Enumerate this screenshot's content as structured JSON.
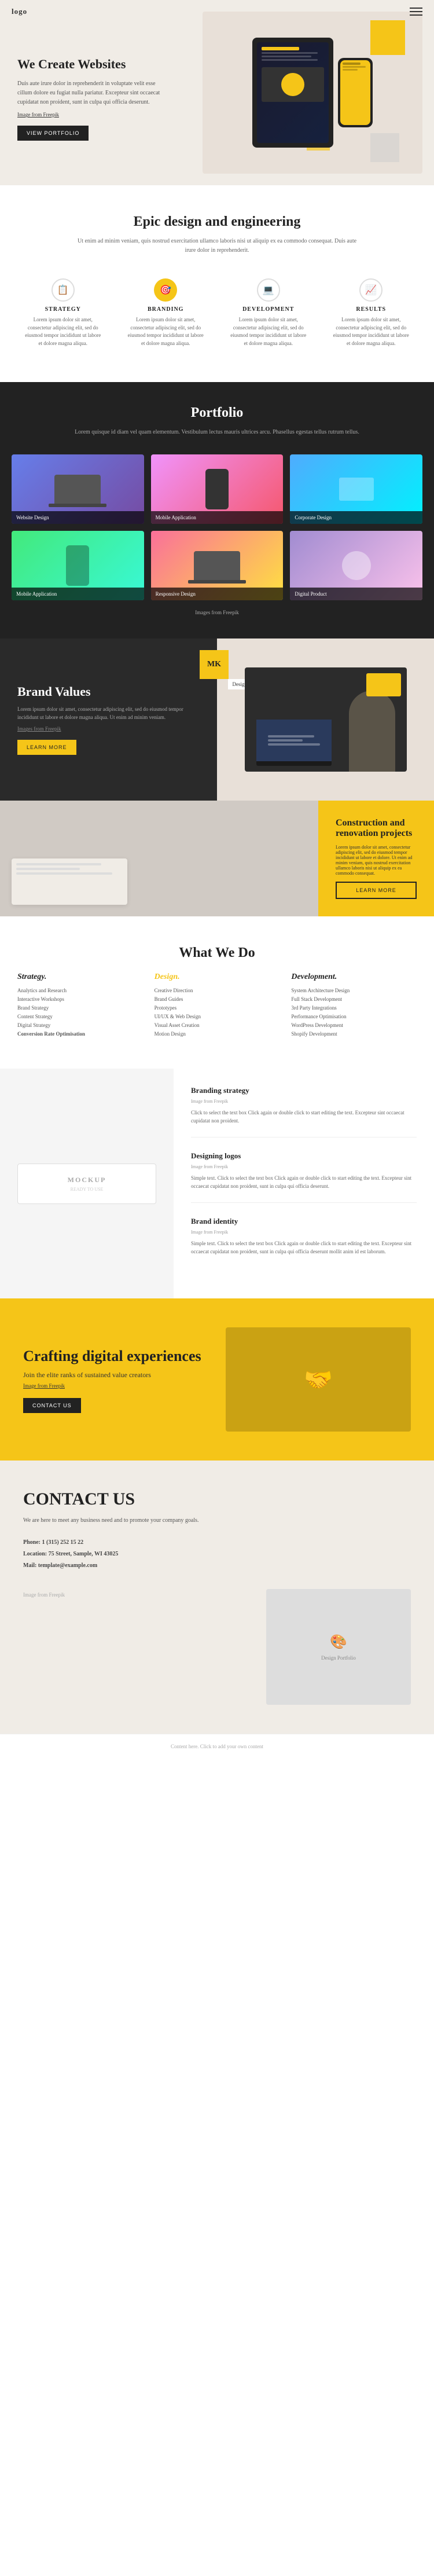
{
  "header": {
    "logo": "logo",
    "menu_icon": "≡"
  },
  "hero": {
    "title": "We Create Websites",
    "description": "Duis aute irure dolor in reprehenderit in voluptate velit esse cillum dolore eu fugiat nulla pariatur. Excepteur sint occaecat cupidatat non proident, sunt in culpa qui officia deserunt.",
    "image_credit": "Image from Freepik",
    "cta_button": "VIEW PORTFOLIO"
  },
  "epic": {
    "title": "Epic design and engineering",
    "subtitle": "Ut enim ad minim veniam, quis nostrud exercitation ullamco laboris nisi ut aliquip ex ea commodo consequat. Duis aute irure dolor in reprehenderit.",
    "features": [
      {
        "label": "STRATEGY",
        "icon": "📋",
        "description": "Lorem ipsum dolor sit amet, consectetur adipiscing elit, sed do eiusmod tempor incididunt ut labore et dolore magna aliqua.",
        "active": false
      },
      {
        "label": "BRANDING",
        "icon": "🎯",
        "description": "Lorem ipsum dolor sit amet, consectetur adipiscing elit, sed do eiusmod tempor incididunt ut labore et dolore magna aliqua.",
        "active": true
      },
      {
        "label": "DEVELOPMENT",
        "icon": "💻",
        "description": "Lorem ipsum dolor sit amet, consectetur adipiscing elit, sed do eiusmod tempor incididunt ut labore et dolore magna aliqua.",
        "active": false
      },
      {
        "label": "RESULTS",
        "icon": "📈",
        "description": "Lorem ipsum dolor sit amet, consectetur adipiscing elit, sed do eiusmod tempor incididunt ut labore et dolore magna aliqua.",
        "active": false
      }
    ]
  },
  "portfolio": {
    "title": "Portfolio",
    "subtitle": "Lorem quisque id diam vel quam elementum. Vestibulum lectus mauris ultrices arcu. Phasellus egestas tellus rutrum tellus.",
    "items": [
      {
        "label": "Website Design",
        "img_class": "img1"
      },
      {
        "label": "Mobile Application",
        "img_class": "img2"
      },
      {
        "label": "Corporate Design",
        "img_class": "img3"
      },
      {
        "label": "Mobile Application",
        "img_class": "img4"
      },
      {
        "label": "Responsive Design",
        "img_class": "img5"
      },
      {
        "label": "Digital Product",
        "img_class": "img6"
      }
    ],
    "credit": "Images from Freepik"
  },
  "brand": {
    "title": "Brand Values",
    "description": "Lorem ipsum dolor sit amet, consectetur adipiscing elit, sed do eiusmod tempor incididunt ut labore et dolore magna aliqua. Ut enim ad minim veniam.",
    "image_credit": "Images from Freepik",
    "cta_button": "LEARN MORE",
    "badge": "MK",
    "badge_label": "Design"
  },
  "construction": {
    "title": "Construction and renovation projects",
    "description": "Lorem ipsum dolor sit amet, consectetur adipiscing elit, sed do eiusmod tempor incididunt ut labore et dolore. Ut enim ad minim veniam, quis nostrud exercitation ullamco laboris nisi ut aliquip ex ea commodo consequat.",
    "cta_button": "LEARN MORE"
  },
  "what": {
    "title": "What We Do",
    "columns": [
      {
        "heading": "Strategy.",
        "color": "normal",
        "items": [
          "Analytics and Research",
          "Interactive Workshops",
          "Brand Strategy",
          "Content Strategy",
          "Digital Strategy",
          "Conversion Rate Optimisation"
        ]
      },
      {
        "heading": "Design.",
        "color": "yellow",
        "items": [
          "Creative Direction",
          "Brand Guides",
          "Prototypes",
          "UI/UX & Web Design",
          "Visual Asset Creation",
          "Motion Design"
        ]
      },
      {
        "heading": "Development.",
        "color": "normal",
        "items": [
          "System Architecture Design",
          "Full Stack Development",
          "3rd Party Integrations",
          "Performance Optimisation",
          "WordPress Development",
          "Shopify Development"
        ]
      }
    ]
  },
  "services": {
    "mockup_title": "MOCKUP",
    "mockup_subtitle": "READY TO USE",
    "entries": [
      {
        "title": "Branding strategy",
        "label": "Image from Freepik",
        "text": "Click to select the text box Click again or double click to start editing the text. Excepteur sint occaecat cupidatat non proident."
      },
      {
        "title": "Designing logos",
        "label": "Image from Freepik",
        "text": "Simple text. Click to select the text box Click again or double click to start editing the text. Excepteur sint occaecat cupidatat non proident, sunt in culpa qui officia deserunt."
      },
      {
        "title": "Brand identity",
        "label": "Image from Freepik",
        "text": "Simple text. Click to select the text box Click again or double click to start editing the text. Excepteur sint occaecat cupidatat non proident, sunt in culpa qui officia deserunt mollit anim id est laborum."
      }
    ]
  },
  "crafting": {
    "title": "Crafting digital experiences",
    "subtitle": "Join the elite ranks of sustained value creators",
    "image_credit": "Image from Freepik",
    "cta_button": "CONTACT US"
  },
  "contact": {
    "title": "CONTACT US",
    "description": "We are here to meet any business need and to promote your company goals.",
    "phone_label": "Phone:",
    "phone": "1 (315) 252 15 22",
    "location_label": "Location:",
    "location": "75 Street, Sample, WI 43025",
    "email_label": "Mail:",
    "email": "template@example.com",
    "image_credit": "Image from Freepik"
  },
  "footer": {
    "text": "Content here. Click to add your own content"
  }
}
